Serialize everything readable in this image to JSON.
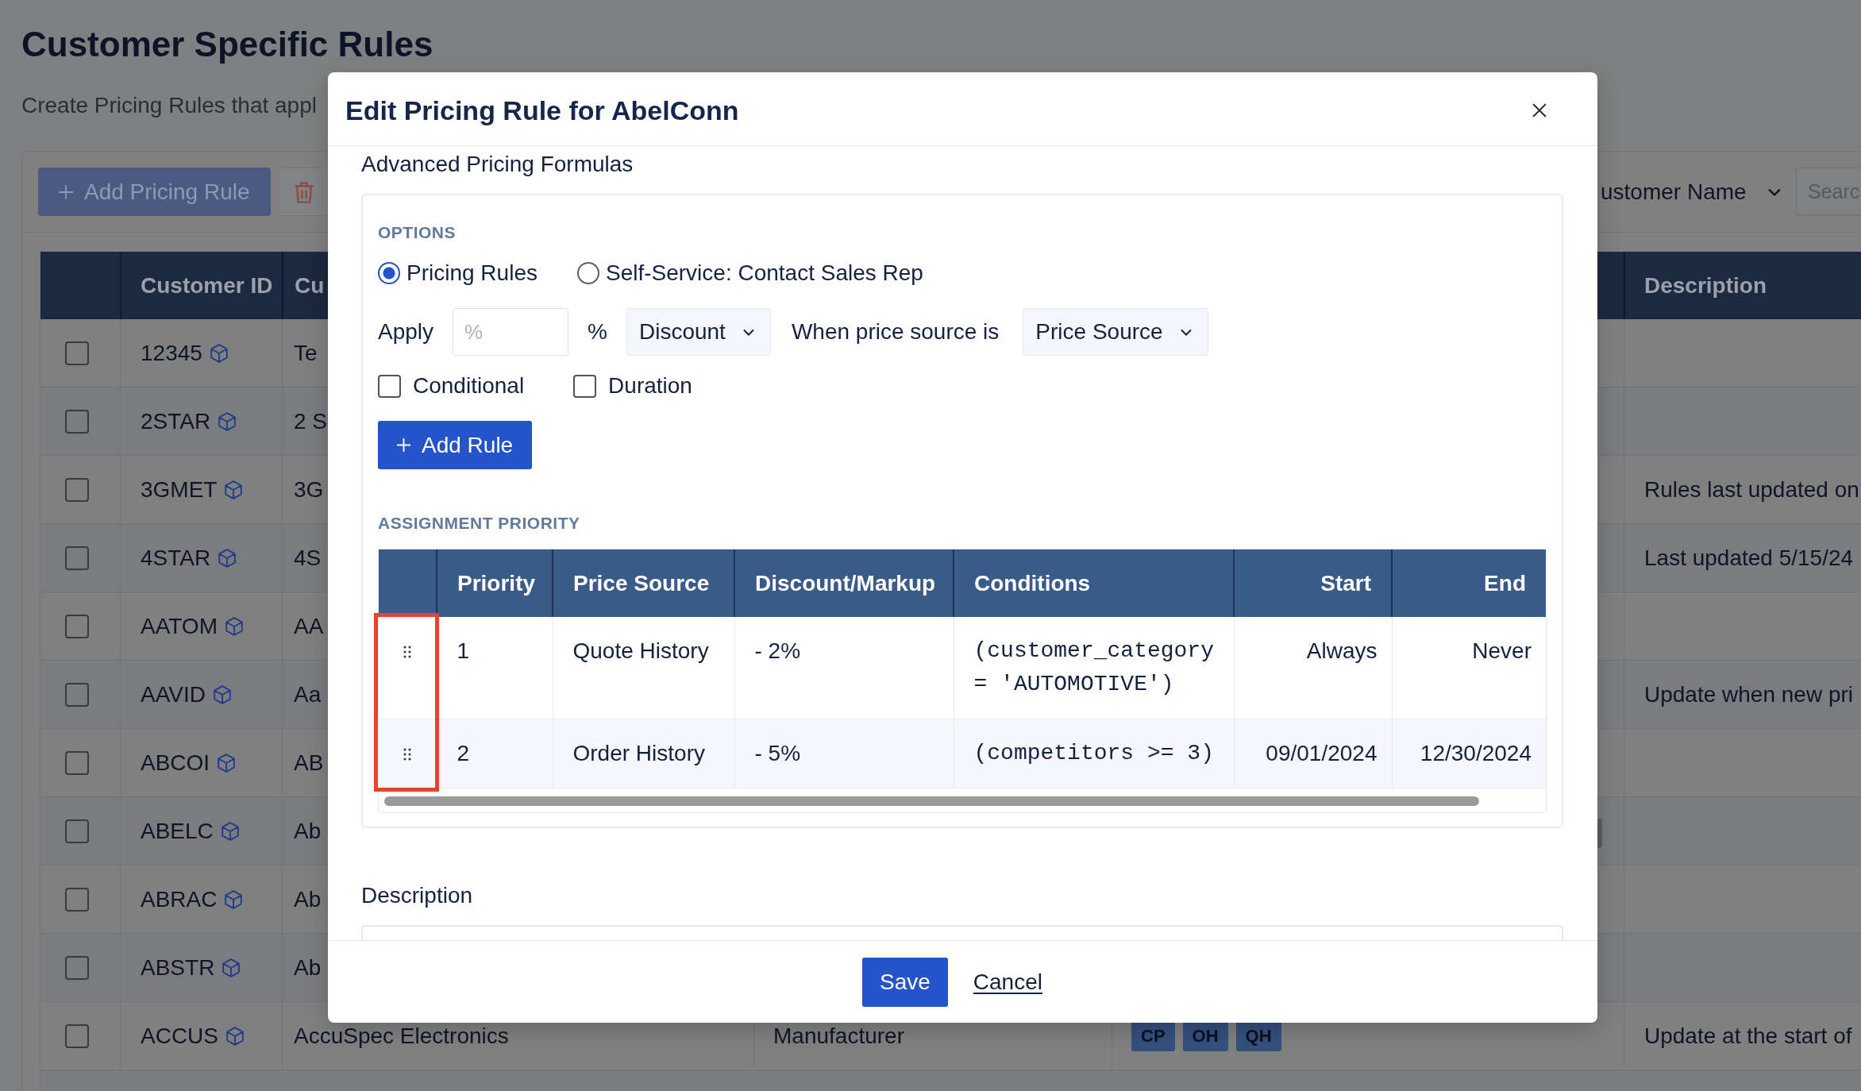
{
  "page": {
    "title": "Customer Specific Rules",
    "subtitle": "Create Pricing Rules that appl"
  },
  "toolbar": {
    "add_button": "Add Pricing Rule",
    "filter_dropdown": "ustomer Name",
    "search": {
      "placeholder": "Searc"
    }
  },
  "customers_table": {
    "header": {
      "customer_id": "Customer ID",
      "column_3": "Cu",
      "description": "Description"
    },
    "rows": [
      {
        "checked": false,
        "customer_id": "12345",
        "column_3": "Te"
      },
      {
        "checked": false,
        "customer_id": "2STAR",
        "column_3": "2 S"
      },
      {
        "checked": false,
        "customer_id": "3GMET",
        "column_3": "3G",
        "description": "Rules last updated on"
      },
      {
        "checked": false,
        "customer_id": "4STAR",
        "column_3": "4S",
        "description": "Last updated 5/15/24"
      },
      {
        "checked": false,
        "customer_id": "AATOM",
        "column_3": "AA"
      },
      {
        "checked": false,
        "customer_id": "AAVID",
        "column_3": "Aa",
        "description": "Update when new pri"
      },
      {
        "checked": false,
        "customer_id": "ABCOI",
        "column_3": "AB"
      },
      {
        "checked": false,
        "customer_id": "ABELC",
        "column_3": "Ab"
      },
      {
        "checked": false,
        "customer_id": "ABRAC",
        "column_3": "Ab"
      },
      {
        "checked": false,
        "customer_id": "ABSTR",
        "column_3": "Ab"
      },
      {
        "checked": false,
        "customer_id": "ACCUS",
        "column_3": "AccuSpec Electronics",
        "column_4": "Manufacturer",
        "column_5": [
          "CP",
          "OH",
          "QH"
        ],
        "description": "Update at the start of"
      }
    ]
  },
  "dialog": {
    "title": "Edit Pricing Rule for AbelConn",
    "section_label": "Advanced Pricing Formulas",
    "options_heading": "OPTIONS",
    "modes": [
      {
        "label": "Pricing Rules",
        "selected": true
      },
      {
        "label": "Self-Service: Contact Sales Rep",
        "selected": false
      }
    ],
    "apply": {
      "label": "Apply",
      "amount": {
        "placeholder": "%"
      },
      "unit": "%",
      "adjustment": "Discount",
      "source_label": "When price source is",
      "source": "Price Source"
    },
    "flags": [
      {
        "label": "Conditional",
        "checked": false
      },
      {
        "label": "Duration",
        "checked": false
      }
    ],
    "add_rule_button": "Add Rule",
    "priority_heading": "ASSIGNMENT PRIORITY",
    "priority_table": {
      "drag_column_highlighted": true,
      "columns": [
        "Priority",
        "Price Source",
        "Discount/Markup",
        "Conditions",
        "Start",
        "End"
      ],
      "rows": [
        {
          "priority": "1",
          "price_source": "Quote History",
          "discount_markup": "- 2%",
          "conditions": "(customer_category = 'AUTOMOTIVE')",
          "start": "Always",
          "end": "Never"
        },
        {
          "priority": "2",
          "price_source": "Order History",
          "discount_markup": "- 5%",
          "conditions": "(competitors >= 3)",
          "start": "09/01/2024",
          "end": "12/30/2024"
        }
      ]
    },
    "description_label": "Description",
    "save_button": "Save",
    "cancel_link": "Cancel"
  }
}
